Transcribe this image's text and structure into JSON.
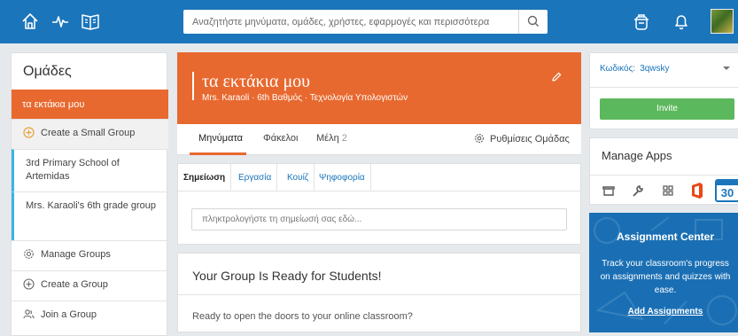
{
  "topbar": {
    "search_placeholder": "Αναζητήστε μηνύματα, ομάδες, χρήστες, εφαρμογές και περισσότερα",
    "icons": [
      "home-icon",
      "activity-icon",
      "library-icon",
      "search-icon",
      "backpack-icon",
      "notifications-icon",
      "avatar"
    ]
  },
  "sidebar": {
    "title": "Ομάδες",
    "active_item": "τα εκτάκια μου",
    "create_small_group": "Create a Small Group",
    "groups": [
      "3rd Primary School of Artemidas",
      "Mrs. Karaoli's 6th grade group"
    ],
    "manage_groups": "Manage Groups",
    "create_group": "Create a Group",
    "join_group": "Join a Group"
  },
  "banner": {
    "title": "τα εκτάκια μου",
    "subtitle": "Mrs. Karaoli · 6th Βαθμός · Τεχνολογία Υπολογιστών"
  },
  "group_tabs": {
    "messages": "Μηνύματα",
    "folders": "Φάκελοι",
    "members": "Μέλη",
    "members_count": "2",
    "settings": "Ρυθμίσεις Ομάδας"
  },
  "composer": {
    "tabs": [
      "Σημείωση",
      "Εργασία",
      "Κουίζ",
      "Ψηφοφορία"
    ],
    "placeholder": "πληκτρολογήστε τη σημείωσή σας εδώ..."
  },
  "ready_card": {
    "heading": "Your Group Is Ready for Students!",
    "text": "Ready to open the doors to your online classroom?"
  },
  "code_panel": {
    "label": "Κωδικός:",
    "code": "3qwsky",
    "invite": "Invite"
  },
  "apps": {
    "title": "Manage Apps",
    "icons": [
      "store-icon",
      "wrench-icon",
      "grid-icon",
      "office-icon",
      "calendar-icon"
    ],
    "calendar_day": "30"
  },
  "assignment_center": {
    "title": "Assignment Center",
    "description": "Track your classroom's progress on assignments and quizzes with ease.",
    "link": "Add Assignments"
  },
  "colors": {
    "topbar": "#1b75bb",
    "accent_orange": "#e8692f",
    "invite_green": "#5cb85c",
    "group_marker": "#3db3e5"
  }
}
